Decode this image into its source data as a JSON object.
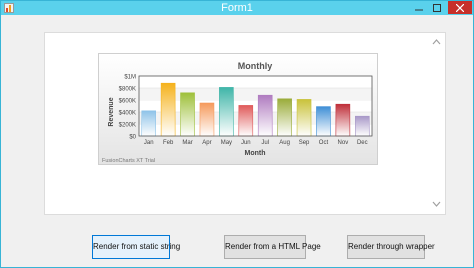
{
  "window": {
    "title": "Form1",
    "controls": [
      "minimize-icon",
      "maximize-icon",
      "close-icon"
    ]
  },
  "buttons": {
    "static_label": "Render from static string",
    "html_label": "Render from  a HTML Page",
    "wrapper_label": "Render through wrapper"
  },
  "chart_data": {
    "type": "bar",
    "title": "Monthly",
    "xlabel": "Month",
    "ylabel": "Revenue",
    "categories": [
      "Jan",
      "Feb",
      "Mar",
      "Apr",
      "May",
      "Jun",
      "Jul",
      "Aug",
      "Sep",
      "Oct",
      "Nov",
      "Dec"
    ],
    "values": [
      420000,
      880000,
      720000,
      550000,
      810000,
      510000,
      680000,
      620000,
      610000,
      490000,
      530000,
      330000
    ],
    "colors": [
      "#8ec3e8",
      "#f5b21c",
      "#9ec03a",
      "#f59a5c",
      "#3fb5a8",
      "#e05a5a",
      "#b07cc0",
      "#9aac3a",
      "#c9c23a",
      "#3f8fd6",
      "#c0303a",
      "#a898c8"
    ],
    "ylim": [
      0,
      1000000
    ],
    "y_ticks": [
      "$0",
      "$200K",
      "$400K",
      "$600K",
      "$800K",
      "$1M"
    ],
    "grid": true,
    "footer": "FusionCharts XT Trial"
  }
}
